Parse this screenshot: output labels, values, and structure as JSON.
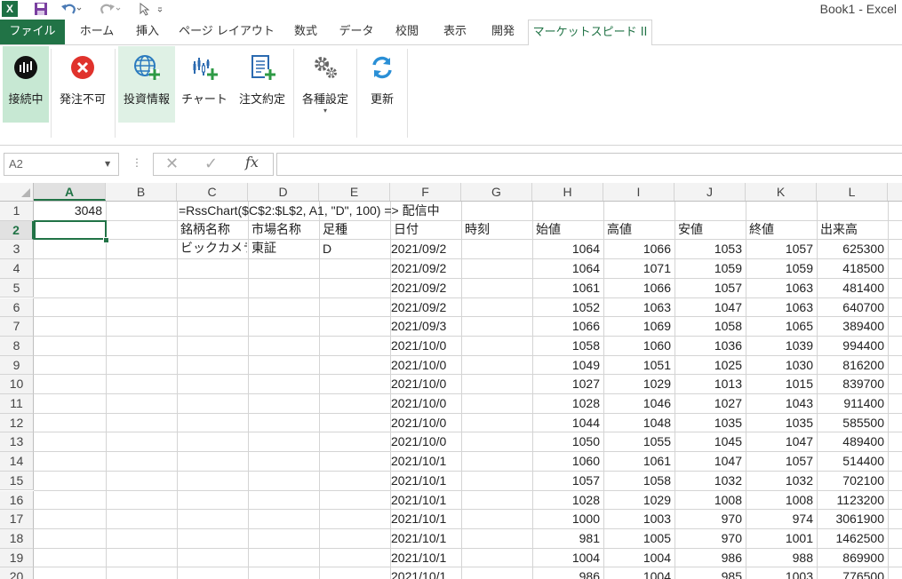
{
  "window": {
    "title": "Book1 - Excel",
    "app_icon": "X"
  },
  "quick_access": {
    "save_icon": "save-icon",
    "undo_icon": "undo-icon",
    "redo_icon": "redo-icon",
    "touch_icon": "touch-mode-icon"
  },
  "tabs": [
    {
      "label": "ファイル"
    },
    {
      "label": "ホーム"
    },
    {
      "label": "挿入"
    },
    {
      "label": "ページ レイアウト"
    },
    {
      "label": "数式"
    },
    {
      "label": "データ"
    },
    {
      "label": "校閲"
    },
    {
      "label": "表示"
    },
    {
      "label": "開発"
    },
    {
      "label": "マーケットスピード II"
    }
  ],
  "ribbon": {
    "connect": {
      "label": "接続中",
      "icon": "connection-icon"
    },
    "order_disabled": {
      "label": "発注不可",
      "icon": "close-circle-icon"
    },
    "invest_info": {
      "label": "投資情報",
      "icon": "globe-plus-icon"
    },
    "chart": {
      "label": "チャート",
      "icon": "chart-plus-icon"
    },
    "order_contract": {
      "label": "注文約定",
      "icon": "document-plus-icon"
    },
    "settings": {
      "label": "各種設定",
      "icon": "gears-icon"
    },
    "refresh": {
      "label": "更新",
      "icon": "refresh-icon"
    }
  },
  "formula_bar": {
    "name_box": "A2",
    "fx": "fx",
    "formula": ""
  },
  "columns": [
    "A",
    "B",
    "C",
    "D",
    "E",
    "F",
    "G",
    "H",
    "I",
    "J",
    "K",
    "L"
  ],
  "rows": [
    "1",
    "2",
    "3",
    "4",
    "5",
    "6",
    "7",
    "8",
    "9",
    "10",
    "11",
    "12",
    "13",
    "14",
    "15",
    "16",
    "17",
    "18",
    "19",
    "20"
  ],
  "cells": {
    "A1": "3048",
    "C1": "=RssChart($C$2:$L$2, A1, \"D\", 100) => 配信中",
    "headers": [
      "銘柄名称",
      "市場名称",
      "足種",
      "日付",
      "時刻",
      "始値",
      "高値",
      "安値",
      "終値",
      "出来高"
    ],
    "C3": "ビックカメラ",
    "D3": "東証",
    "E3": "D"
  },
  "data_rows": [
    {
      "date": "2021/09/2",
      "open": "1064",
      "high": "1066",
      "low": "1053",
      "close": "1057",
      "volume": "625300"
    },
    {
      "date": "2021/09/2",
      "open": "1064",
      "high": "1071",
      "low": "1059",
      "close": "1059",
      "volume": "418500"
    },
    {
      "date": "2021/09/2",
      "open": "1061",
      "high": "1066",
      "low": "1057",
      "close": "1063",
      "volume": "481400"
    },
    {
      "date": "2021/09/2",
      "open": "1052",
      "high": "1063",
      "low": "1047",
      "close": "1063",
      "volume": "640700"
    },
    {
      "date": "2021/09/3",
      "open": "1066",
      "high": "1069",
      "low": "1058",
      "close": "1065",
      "volume": "389400"
    },
    {
      "date": "2021/10/0",
      "open": "1058",
      "high": "1060",
      "low": "1036",
      "close": "1039",
      "volume": "994400"
    },
    {
      "date": "2021/10/0",
      "open": "1049",
      "high": "1051",
      "low": "1025",
      "close": "1030",
      "volume": "816200"
    },
    {
      "date": "2021/10/0",
      "open": "1027",
      "high": "1029",
      "low": "1013",
      "close": "1015",
      "volume": "839700"
    },
    {
      "date": "2021/10/0",
      "open": "1028",
      "high": "1046",
      "low": "1027",
      "close": "1043",
      "volume": "911400"
    },
    {
      "date": "2021/10/0",
      "open": "1044",
      "high": "1048",
      "low": "1035",
      "close": "1035",
      "volume": "585500"
    },
    {
      "date": "2021/10/0",
      "open": "1050",
      "high": "1055",
      "low": "1045",
      "close": "1047",
      "volume": "489400"
    },
    {
      "date": "2021/10/1",
      "open": "1060",
      "high": "1061",
      "low": "1047",
      "close": "1057",
      "volume": "514400"
    },
    {
      "date": "2021/10/1",
      "open": "1057",
      "high": "1058",
      "low": "1032",
      "close": "1032",
      "volume": "702100"
    },
    {
      "date": "2021/10/1",
      "open": "1028",
      "high": "1029",
      "low": "1008",
      "close": "1008",
      "volume": "1123200"
    },
    {
      "date": "2021/10/1",
      "open": "1000",
      "high": "1003",
      "low": "970",
      "close": "974",
      "volume": "3061900"
    },
    {
      "date": "2021/10/1",
      "open": "981",
      "high": "1005",
      "low": "970",
      "close": "1001",
      "volume": "1462500"
    },
    {
      "date": "2021/10/1",
      "open": "1004",
      "high": "1004",
      "low": "986",
      "close": "988",
      "volume": "869900"
    },
    {
      "date": "2021/10/1",
      "open": "986",
      "high": "1004",
      "low": "985",
      "close": "1003",
      "volume": "776500"
    }
  ],
  "colors": {
    "excel_green": "#217346",
    "selected_ribbon": "#c7e8d3"
  }
}
